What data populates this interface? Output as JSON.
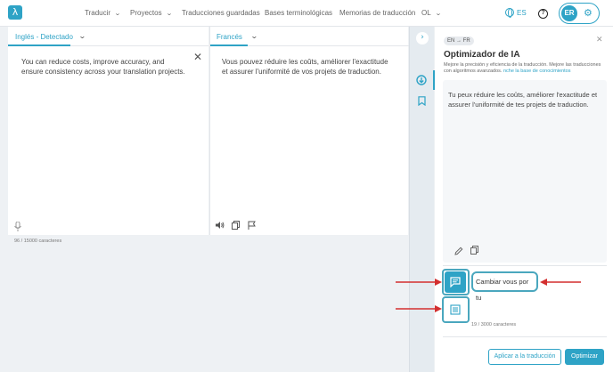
{
  "nav": {
    "logo": "λ",
    "items": [
      "Traducir",
      "Proyectos",
      "Traducciones guardadas",
      "Bases terminológicas",
      "Memorias de traducción",
      "OL"
    ],
    "lang": "ES",
    "user_initials": "ER"
  },
  "source": {
    "tab_label": "Inglés - Detectado",
    "text": "You can reduce costs, improve accuracy, and ensure consistency across your translation projects.",
    "char_count": "96 / 15000 caracteres"
  },
  "target": {
    "tab_label": "Francés",
    "text": "Vous pouvez réduire les coûts, améliorer l'exactitude et assurer l'uniformité de vos projets de traduction."
  },
  "ai": {
    "lang_badge": "EN → FR",
    "title": "Optimizador de IA",
    "description": "Mejore la precisión y eficiencia de la traducción. Mejore las traducciones con algoritmos avanzados.",
    "description_link": "nche la base de conocimientos",
    "suggestion": "Tu peux réduire les coûts, améliorer l'exactitude et assurer l'uniformité de tes projets de traduction.",
    "instruction_value": "Cambiar vous por tu",
    "instruction_count": "19 / 3000 caracteres",
    "apply_label": "Aplicar a la traducción",
    "optimize_label": "Optimizar"
  },
  "colors": {
    "accent": "#2ea3c6",
    "annotation": "#d32f2f"
  },
  "icons": [
    "close-icon",
    "microphone-icon",
    "speaker-icon",
    "copy-icon",
    "flag-icon",
    "chevron-right-icon",
    "download-icon",
    "bookmark-icon",
    "edit-icon",
    "chat-icon",
    "list-icon",
    "gear-icon",
    "help-icon",
    "globe-icon"
  ]
}
